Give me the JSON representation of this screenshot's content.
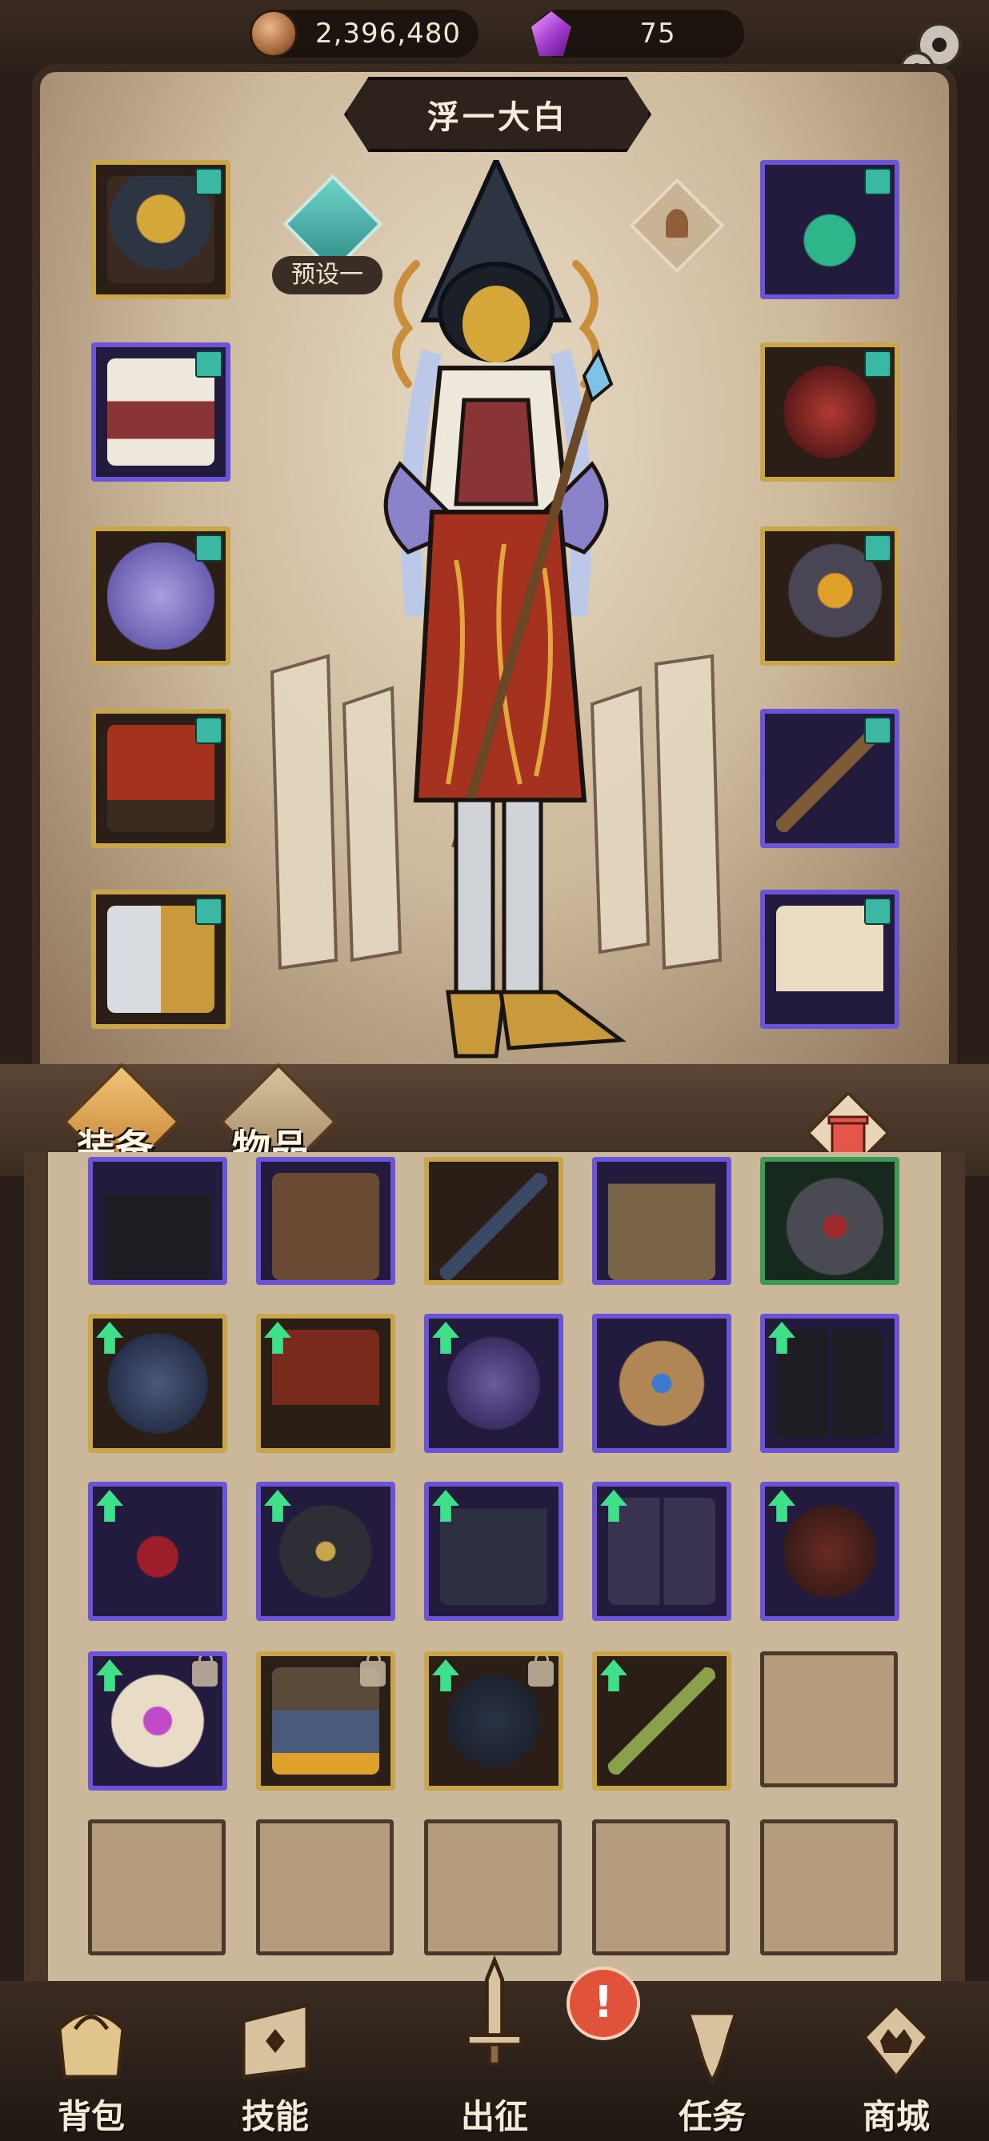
{
  "currency": {
    "coins": "2,396,480",
    "gems": "75"
  },
  "hero": {
    "name": "浮一大白",
    "preset_label": "预设一"
  },
  "tabs": {
    "equipment": "装备",
    "items": "物品"
  },
  "nav": {
    "bag": "背包",
    "skills": "技能",
    "expedition": "出征",
    "tasks": "任务",
    "shop": "商城",
    "alert": "!"
  },
  "colors": {
    "gold_frame": "#c9a64b",
    "purple_frame": "#6b55d6",
    "green_frame": "#3f9a5a",
    "upgrade_arrow": "#3fe08a",
    "alert_red": "#e0523a"
  },
  "icons": {
    "coin": "coin-icon",
    "gem": "gem-icon",
    "settings": "gear-icon",
    "trash": "trash-icon"
  }
}
